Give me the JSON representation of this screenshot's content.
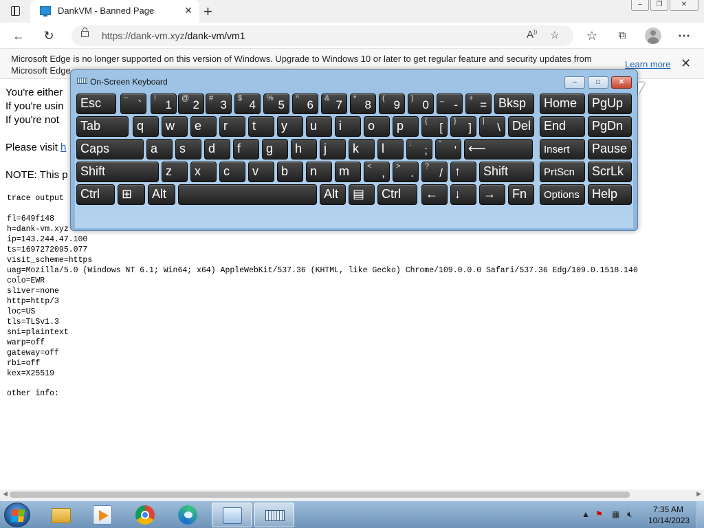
{
  "browser": {
    "tab_title": "DankVM - Banned Page",
    "tab_close": "✕",
    "new_tab": "+",
    "url_host": "https://dank-vm.xyz",
    "url_path": "/dank-vm/vm1",
    "win_minimize": "–",
    "win_maximize": "❐",
    "win_close": "✕"
  },
  "infobar": {
    "message": "Microsoft Edge is no longer supported on this version of Windows. Upgrade to Windows 10 or later to get regular feature and security updates from Microsoft Edge.",
    "learn_more": "Learn more",
    "close": "✕"
  },
  "page": {
    "line1": "You're either",
    "line2": "If you're usin",
    "line3": "If you're not",
    "visit_prefix": "Please visit",
    "visit_link": "h",
    "note": "NOTE: This p",
    "trace_header": "trace output",
    "trace_lines": [
      "fl=649f148",
      "h=dank-vm.xyz",
      "ip=143.244.47.100",
      "ts=1697272095.077",
      "visit_scheme=https",
      "uag=Mozilla/5.0 (Windows NT 6.1; Win64; x64) AppleWebKit/537.36 (KHTML, like Gecko) Chrome/109.0.0.0 Safari/537.36 Edg/109.0.1518.140",
      "colo=EWR",
      "sliver=none",
      "http=http/3",
      "loc=US",
      "tls=TLSv1.3",
      "sni=plaintext",
      "warp=off",
      "gateway=off",
      "rbi=off",
      "kex=X25519"
    ],
    "other_info": "other info:"
  },
  "osk": {
    "title": "On-Screen Keyboard",
    "minimize": "–",
    "maximize": "□",
    "close": "✕",
    "rows": [
      [
        {
          "label": "Esc"
        },
        {
          "shift": "~",
          "main": "`"
        },
        {
          "shift": "!",
          "main": "1"
        },
        {
          "shift": "@",
          "main": "2"
        },
        {
          "shift": "#",
          "main": "3"
        },
        {
          "shift": "$",
          "main": "4"
        },
        {
          "shift": "%",
          "main": "5"
        },
        {
          "shift": "^",
          "main": "6"
        },
        {
          "shift": "&",
          "main": "7"
        },
        {
          "shift": "*",
          "main": "8"
        },
        {
          "shift": "(",
          "main": "9"
        },
        {
          "shift": ")",
          "main": "0"
        },
        {
          "shift": "_",
          "main": "-"
        },
        {
          "shift": "+",
          "main": "="
        },
        {
          "label": "Bksp"
        },
        {
          "label": "Home"
        },
        {
          "label": "PgUp"
        }
      ],
      [
        {
          "label": "Tab"
        },
        {
          "label": "q"
        },
        {
          "label": "w"
        },
        {
          "label": "e"
        },
        {
          "label": "r"
        },
        {
          "label": "t"
        },
        {
          "label": "y"
        },
        {
          "label": "u"
        },
        {
          "label": "i"
        },
        {
          "label": "o"
        },
        {
          "label": "p"
        },
        {
          "shift": "{",
          "main": "["
        },
        {
          "shift": "}",
          "main": "]"
        },
        {
          "shift": "|",
          "main": "\\"
        },
        {
          "label": "Del"
        },
        {
          "label": "End"
        },
        {
          "label": "PgDn"
        }
      ],
      [
        {
          "label": "Caps"
        },
        {
          "label": "a"
        },
        {
          "label": "s"
        },
        {
          "label": "d"
        },
        {
          "label": "f"
        },
        {
          "label": "g"
        },
        {
          "label": "h"
        },
        {
          "label": "j"
        },
        {
          "label": "k"
        },
        {
          "label": "l"
        },
        {
          "shift": ":",
          "main": ";"
        },
        {
          "shift": "\"",
          "main": "'"
        },
        {
          "label": "⟵"
        },
        {
          "label": "Insert"
        },
        {
          "label": "Pause"
        }
      ],
      [
        {
          "label": "Shift"
        },
        {
          "label": "z"
        },
        {
          "label": "x"
        },
        {
          "label": "c"
        },
        {
          "label": "v"
        },
        {
          "label": "b"
        },
        {
          "label": "n"
        },
        {
          "label": "m"
        },
        {
          "shift": "<",
          "main": ","
        },
        {
          "shift": ">",
          "main": "."
        },
        {
          "shift": "?",
          "main": "/"
        },
        {
          "label": "↑"
        },
        {
          "label": "Shift"
        },
        {
          "label": "PrtScn"
        },
        {
          "label": "ScrLk"
        }
      ],
      [
        {
          "label": "Ctrl"
        },
        {
          "label": "⊞"
        },
        {
          "label": "Alt"
        },
        {
          "label": ""
        },
        {
          "label": "Alt"
        },
        {
          "label": "▤"
        },
        {
          "label": "Ctrl"
        },
        {
          "label": "←"
        },
        {
          "label": "↓"
        },
        {
          "label": "→"
        },
        {
          "label": "Fn"
        },
        {
          "label": "Options"
        },
        {
          "label": "Help"
        }
      ]
    ]
  },
  "taskbar": {
    "items": [
      "Windows Explorer",
      "Windows Media Player",
      "Google Chrome",
      "Microsoft Edge",
      "Control Panel",
      "On-Screen Keyboard"
    ],
    "clock_time": "7:35 AM",
    "clock_date": "10/14/2023",
    "colors": {
      "chrome_red": "#db4437",
      "chrome_green": "#0f9d58",
      "chrome_yellow": "#f4b400",
      "chrome_blue": "#4285f4",
      "edge_blue": "#1b6fd1",
      "edge_green": "#3cc37a"
    }
  }
}
